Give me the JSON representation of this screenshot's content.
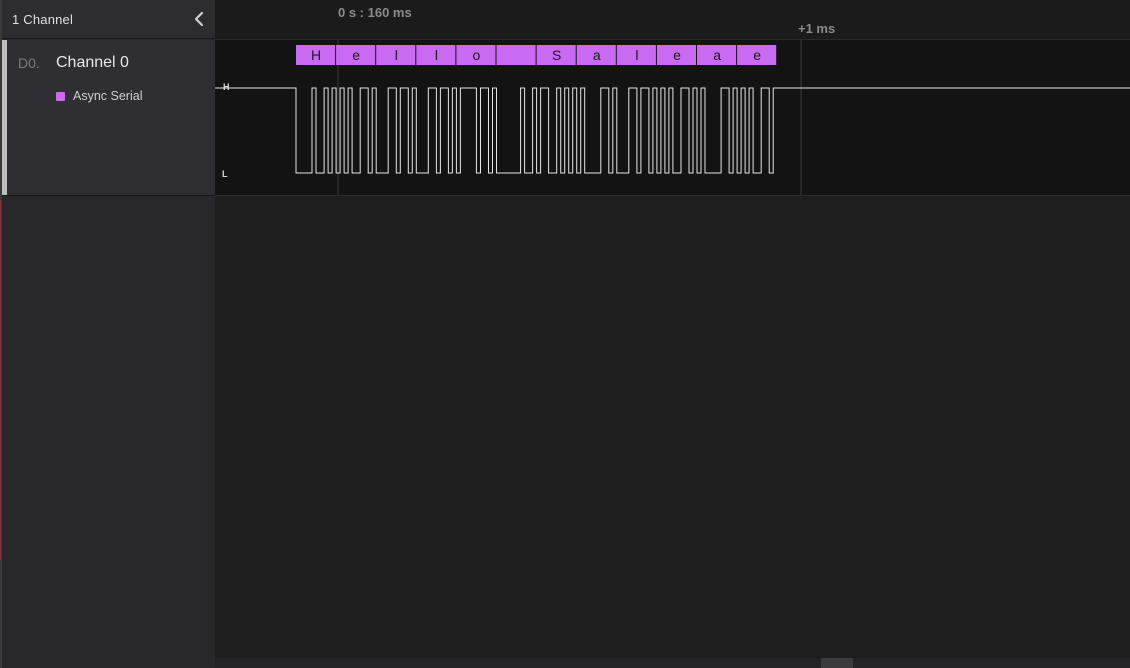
{
  "sidebar": {
    "channel_count": "1 Channel",
    "collapse_icon": "chevron-left-icon",
    "channel": {
      "id": "D0.",
      "name": "Channel 0",
      "analyzer": {
        "name": "Async Serial",
        "color": "#c86bf2"
      }
    }
  },
  "timeline": {
    "main_label": "0 s : 160 ms",
    "plus_label": "+1 ms"
  },
  "waveform": {
    "high_label": "H",
    "low_label": "L",
    "decoded_frames": [
      "H",
      "e",
      "l",
      "l",
      "o",
      " ",
      "S",
      "a",
      "l",
      "e",
      "a",
      "e"
    ]
  },
  "colors": {
    "background": "#1e1e1e",
    "sidebar": "#28282b",
    "lane": "#131313",
    "decode_accent": "#c86bf2",
    "signal": "#e6e6e6"
  }
}
